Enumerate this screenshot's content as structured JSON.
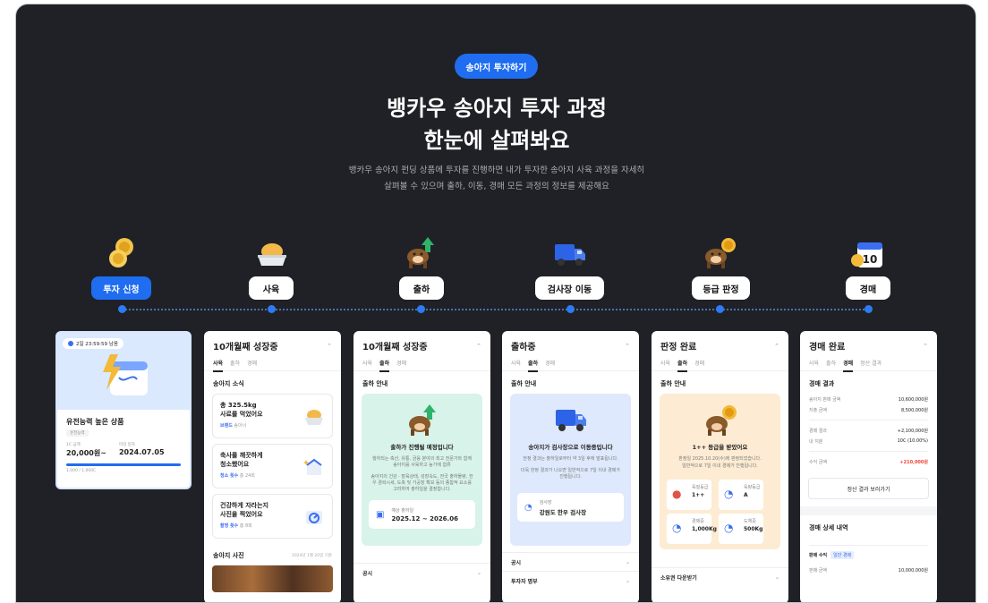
{
  "badge": "송아지 투자하기",
  "title_line1": "뱅카우 송아지 투자 과정",
  "title_line2": "한눈에 살펴봐요",
  "subtitle_line1": "뱅카우 송아지 펀딩 상품에 투자를 진행하면 내가 투자한 송아지 사육 과정을 자세히",
  "subtitle_line2": "살펴볼 수 있으며 출하, 이동, 경매 모든 과정의 정보를 제공해요",
  "steps": [
    {
      "label": "투자 신청",
      "icon": "coins-icon"
    },
    {
      "label": "사육",
      "icon": "feed-bowl-icon"
    },
    {
      "label": "출하",
      "icon": "cow-arrow-icon"
    },
    {
      "label": "검사장 이동",
      "icon": "truck-icon"
    },
    {
      "label": "등급 판정",
      "icon": "cow-medal-icon"
    },
    {
      "label": "경매",
      "icon": "calendar-10-icon"
    }
  ],
  "colors": {
    "background": "#202126",
    "accent": "#1f6df1",
    "negative": "#f14437"
  },
  "card1": {
    "timer": "2일 23:59:59 남음",
    "product": "유전능력 높은 상품",
    "tag": "유전능력",
    "label_price": "1C 금액",
    "price": "20,000원~",
    "label_date": "마감 일자",
    "date": "2024.07.05",
    "progress_text": "1,000 / 1,000C",
    "progress_ratio": 1.0
  },
  "card2": {
    "title": "10개월째 성장중",
    "tabs": [
      "사육",
      "출하",
      "경매"
    ],
    "section": "송아지 소식",
    "news": [
      {
        "line1": "총 325.5kg",
        "line2": "사료를 먹었어요",
        "meta_key": "브랜드",
        "meta_val": "송아너"
      },
      {
        "line1": "축사를 깨끗하게",
        "line2": "청소했어요",
        "meta_key": "청소 횟수",
        "meta_val": "총 24회"
      },
      {
        "line1": "건강하게 자라는지",
        "line2": "사진을 찍었어요",
        "meta_key": "촬영 횟수",
        "meta_val": "총 8회"
      }
    ],
    "photo_title": "송아지 사진",
    "photo_date": "2024년 1월 20일 기준"
  },
  "card3": {
    "title": "10개월째 성장중",
    "tabs": [
      "사육",
      "출하",
      "경매"
    ],
    "section": "출하 안내",
    "headline": "출하가 진행될 예정입니다",
    "desc1": "행하되는 축산, 유통, 금융 분야의 최고 전문가와 함께 송아지를 사육하고 농가에 합류",
    "desc2": "송아지의 건강 · 발육상태, 성장속도, 전국 출하물량, 한우 경락시세, 도축 및 가공장 확보 등의 종합적 요소를 고려하여 출하일을 결정합니다.",
    "date_label": "예상 출하일",
    "date_range": "2025.12 ~ 2026.06",
    "row1": "공시"
  },
  "card4": {
    "title": "출하중",
    "tabs": [
      "사육",
      "출하",
      "경매"
    ],
    "section": "출하 안내",
    "headline": "송아지가 검사장으로 이동중입니다",
    "desc1": "한정 결과는 출하일로부터 약 3일 후에 발표됩니다.",
    "desc2": "더욱 한정 결과가 나오면 일반적으로 7일 이내 경매가 진행됩니다.",
    "place_label": "검사장",
    "place": "강원도 한우 검사장",
    "row1": "공시",
    "row2": "투자자 명부"
  },
  "card5": {
    "title": "판정 완료",
    "tabs": [
      "사육",
      "출하",
      "경매"
    ],
    "section": "출하 안내",
    "headline": "1++ 등급을 받았어요",
    "desc1": "판정일 2025.10.20(수)에 판정되었습니다.",
    "desc2": "일반적으로 7일 이내 경매가 진행됩니다.",
    "cells": [
      {
        "label": "육질등급",
        "value": "1++"
      },
      {
        "label": "육량등급",
        "value": "A"
      },
      {
        "label": "경매중",
        "value": "1,000Kg"
      },
      {
        "label": "도체중",
        "value": "500Kg"
      }
    ],
    "row1": "소유권 다운받기"
  },
  "card6": {
    "title": "경매 완료",
    "tabs": [
      "사육",
      "출하",
      "경매",
      "정산 결과"
    ],
    "section": "경매 결과",
    "rows": [
      {
        "k": "송아지 판매 금액",
        "v": "10,600,000원"
      },
      {
        "k": "지출 금액",
        "v": "8,500,000원"
      },
      {
        "k": "경매 결과",
        "v": "+2,100,000원"
      },
      {
        "k": "내 지분",
        "v": "10C (10.00%)"
      },
      {
        "k": "수익 금액",
        "v": "+210,000원"
      }
    ],
    "button": "정산 결과 보러가기",
    "detail_title": "경매 상세 내역",
    "detail_sub": "판매 수익",
    "detail_tag": "일반 경매",
    "detail_key": "판매 금액",
    "detail_val": "10,000,000원"
  }
}
